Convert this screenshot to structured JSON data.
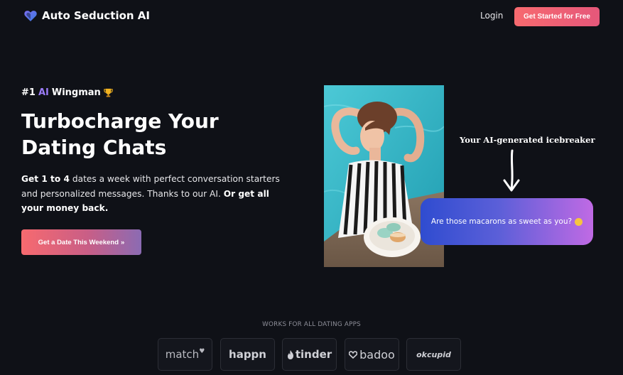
{
  "header": {
    "brand_name": "Auto Seduction AI",
    "login_label": "Login",
    "cta_label": "Get Started for Free"
  },
  "hero": {
    "badge_prefix": "#1",
    "badge_ai": "AI",
    "badge_suffix": "Wingman",
    "title": "Turbocharge Your Dating Chats",
    "desc_part1": "Get 1 to 4",
    "desc_part2": " dates a week with perfect conversation starters and personalized messages. Thanks to our AI. ",
    "desc_part3": "Or get all your money back.",
    "cta_label": "Get a Date This Weekend",
    "cta_chevron": "»"
  },
  "demo": {
    "icebreaker_label": "Your AI-generated icebreaker",
    "message": "Are those macarons as sweet as you?"
  },
  "apps": {
    "label": "WORKS FOR ALL DATING APPS",
    "items": [
      "match",
      "happn",
      "tinder",
      "badoo",
      "okcupid"
    ]
  },
  "colors": {
    "background": "#0f1117",
    "accent_coral": "#f76a6f",
    "accent_purple": "#9b7cf7",
    "bubble_blue": "#2f4cd0",
    "bubble_violet": "#c06ae4"
  },
  "icons": {
    "logo": "heart-logo-icon",
    "trophy": "trophy-icon",
    "chevron": "double-chevron-right-icon",
    "arrow": "down-arrow-icon",
    "emoji": "blushing-face-icon"
  }
}
